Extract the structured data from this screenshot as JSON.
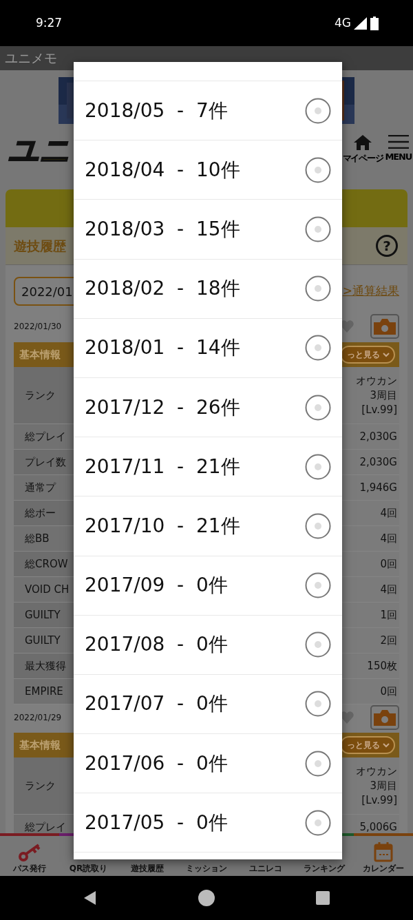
{
  "status_bar": {
    "time": "9:27",
    "network": "4G"
  },
  "app_bar": {
    "title": "ユニメモ"
  },
  "header": {
    "logo": "ユニ",
    "links": [
      {
        "label": "マイページ",
        "kind": "home"
      },
      {
        "label": "MENU",
        "kind": "menu"
      }
    ]
  },
  "section": {
    "title": "遊技履歴",
    "help": "?"
  },
  "filter": {
    "month": "2022/01",
    "total_link": ">通算結果"
  },
  "sessions": [
    {
      "date": "2022/01/30",
      "heading": "基本情報",
      "more": "っと見る",
      "rows": [
        {
          "label": "ランク",
          "value": "オウカン 3周目 [Lv.99]"
        },
        {
          "label": "総プレイ",
          "value": "2,030G"
        },
        {
          "label": "プレイ数",
          "value": "2,030G"
        },
        {
          "label": "通常プ",
          "value": "1,946G"
        },
        {
          "label": "総ボー",
          "value": "4回"
        },
        {
          "label": "総BB",
          "value": "4回"
        },
        {
          "label": "総CROW",
          "value": "0回"
        },
        {
          "label": "VOID CH",
          "value": "4回"
        },
        {
          "label": "GUILTY",
          "value": "1回"
        },
        {
          "label": "GUILTY",
          "value": "2回"
        },
        {
          "label": "最大獲得",
          "value": "150枚"
        },
        {
          "label": "EMPIRE",
          "value": "0回"
        }
      ]
    },
    {
      "date": "2022/01/29",
      "heading": "基本情報",
      "more": "っと見る",
      "rows": [
        {
          "label": "ランク",
          "value": "オウカン 3周目 [Lv.99]"
        },
        {
          "label": "総プレイ",
          "value": "5,006G"
        }
      ]
    }
  ],
  "bottom_nav": [
    {
      "label": "パス発行",
      "kind": "key",
      "color": "#7a1c22"
    },
    {
      "label": "QR読取り",
      "color": "#6a1e6a"
    },
    {
      "label": "遊技履歴"
    },
    {
      "label": "ミッション"
    },
    {
      "label": "ユニレコ"
    },
    {
      "label": "ランキング",
      "color": "#1e5a2a"
    },
    {
      "label": "カレンダー",
      "kind": "calendar",
      "color": "#7a420e"
    }
  ],
  "dialog": {
    "options": [
      {
        "label": "2018/05  -  7件",
        "selected": false
      },
      {
        "label": "2018/04  -  10件",
        "selected": false
      },
      {
        "label": "2018/03  -  15件",
        "selected": false
      },
      {
        "label": "2018/02  -  18件",
        "selected": false
      },
      {
        "label": "2018/01  -  14件",
        "selected": false
      },
      {
        "label": "2017/12  -  26件",
        "selected": false
      },
      {
        "label": "2017/11  -  21件",
        "selected": false
      },
      {
        "label": "2017/10  -  21件",
        "selected": false
      },
      {
        "label": "2017/09  -  0件",
        "selected": false
      },
      {
        "label": "2017/08  -  0件",
        "selected": false
      },
      {
        "label": "2017/07  -  0件",
        "selected": false
      },
      {
        "label": "2017/06  -  0件",
        "selected": false
      },
      {
        "label": "2017/05  -  0件",
        "selected": false
      }
    ]
  }
}
